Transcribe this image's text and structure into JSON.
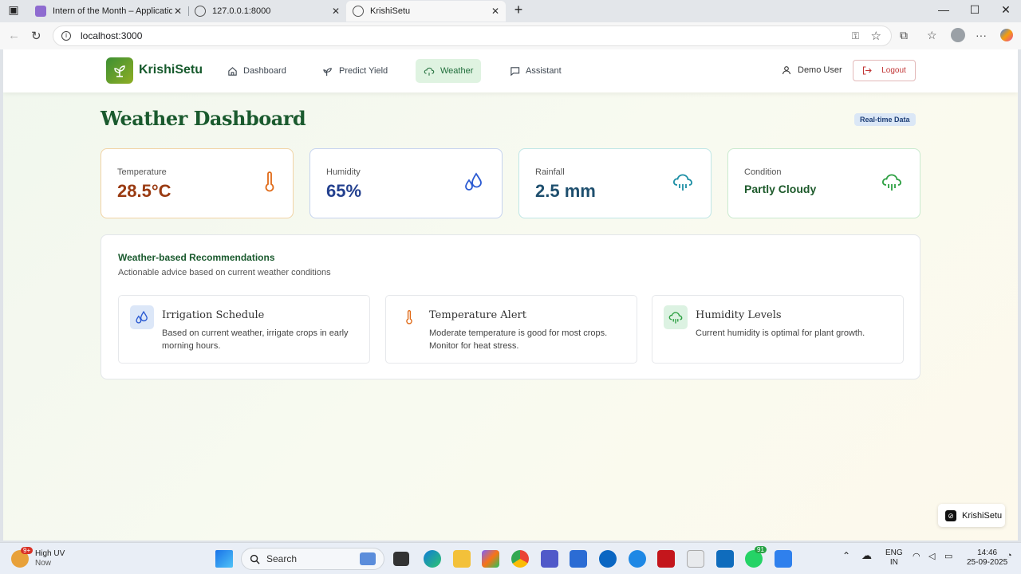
{
  "browser": {
    "tabs": [
      {
        "title": "Intern of the Month – Application"
      },
      {
        "title": "127.0.0.1:8000"
      },
      {
        "title": "KrishiSetu"
      }
    ],
    "url": "localhost:3000"
  },
  "app": {
    "brand": "KrishiSetu",
    "nav": [
      {
        "label": "Dashboard",
        "icon": "home-icon"
      },
      {
        "label": "Predict Yield",
        "icon": "sprout-icon"
      },
      {
        "label": "Weather",
        "icon": "cloud-icon",
        "active": true
      },
      {
        "label": "Assistant",
        "icon": "chat-icon"
      }
    ],
    "user": "Demo User",
    "logout": "Logout"
  },
  "main": {
    "title": "Weather Dashboard",
    "badge": "Real-time Data",
    "stats": [
      {
        "label": "Temperature",
        "value": "28.5°C",
        "color": "#9a3b12",
        "icon": "thermometer-icon"
      },
      {
        "label": "Humidity",
        "value": "65%",
        "color": "#24418f",
        "icon": "droplets-icon"
      },
      {
        "label": "Rainfall",
        "value": "2.5 mm",
        "color": "#1e4f6e",
        "icon": "cloud-rain-icon"
      },
      {
        "label": "Condition",
        "value": "Partly Cloudy",
        "color": "#1d5a2b",
        "icon": "cloud-drizzle-icon"
      }
    ],
    "recommendations": {
      "title": "Weather-based Recommendations",
      "subtitle": "Actionable advice based on current weather conditions",
      "cards": [
        {
          "title": "Irrigation Schedule",
          "text": "Based on current weather, irrigate crops in early morning hours.",
          "icon": "droplets-icon"
        },
        {
          "title": "Temperature Alert",
          "text": "Moderate temperature is good for most crops. Monitor for heat stress.",
          "icon": "thermometer-icon"
        },
        {
          "title": "Humidity Levels",
          "text": "Current humidity is optimal for plant growth.",
          "icon": "cloud-rain-icon"
        }
      ]
    },
    "floating_badge": "KrishiSetu"
  },
  "taskbar": {
    "weather_title": "High UV",
    "weather_sub": "Now",
    "weather_badge": "9+",
    "search": "Search",
    "lang": "ENG",
    "region": "IN",
    "time": "14:46",
    "date": "25-09-2025",
    "whatsapp_badge": "91"
  }
}
